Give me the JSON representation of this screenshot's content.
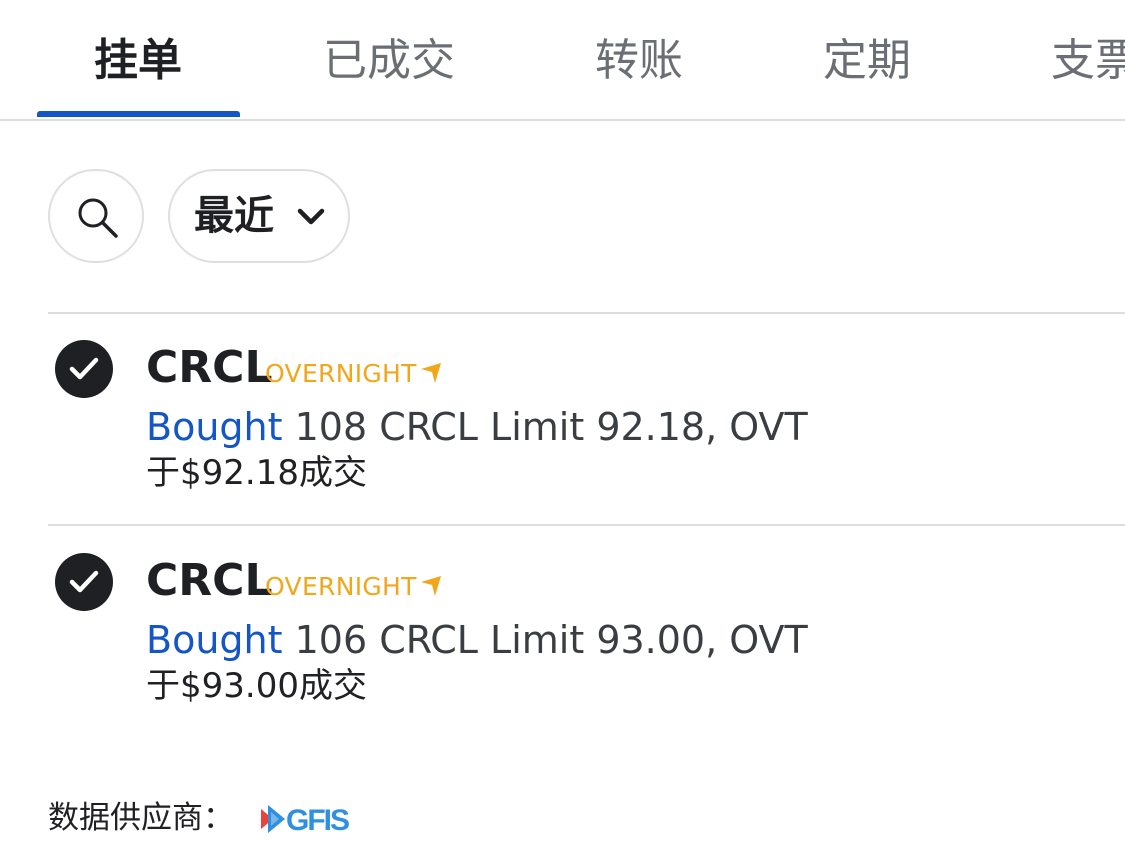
{
  "tabs": [
    {
      "label": "挂单",
      "active": true
    },
    {
      "label": "已成交",
      "active": false
    },
    {
      "label": "转账",
      "active": false
    },
    {
      "label": "定期",
      "active": false
    },
    {
      "label": "支票",
      "active": false
    }
  ],
  "filters": {
    "search_icon": "search-icon",
    "range_label": "最近",
    "range_icon": "chevron-down-icon"
  },
  "orders": [
    {
      "symbol": "CRCL",
      "session": "OVERNIGHT",
      "action": "Bought",
      "detail": " 108 CRCL Limit 92.18, OVT",
      "fill": "于$92.18成交",
      "status_icon": "check-circle-icon"
    },
    {
      "symbol": "CRCL",
      "session": "OVERNIGHT",
      "action": "Bought",
      "detail": " 106 CRCL Limit 93.00, OVT",
      "fill": "于$93.00成交",
      "status_icon": "check-circle-icon"
    }
  ],
  "footer": {
    "provider_label": "数据供应商：",
    "provider_name": "GFIS"
  },
  "colors": {
    "accent": "#1456c6",
    "overnight": "#f2a71b",
    "text": "#202124",
    "divider": "#dcdde0"
  }
}
